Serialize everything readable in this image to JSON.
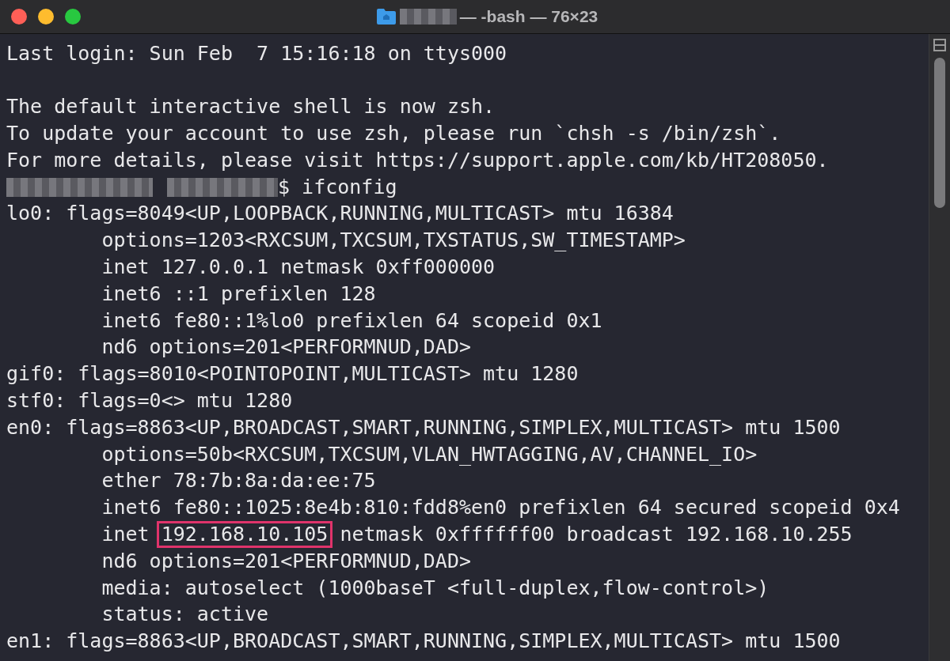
{
  "window": {
    "title": "— -bash — 76×23",
    "title_redacted": true
  },
  "terminal": {
    "lines": [
      {
        "kind": "output",
        "parts": [
          {
            "text": "Last login: Sun Feb  7 15:16:18 on ttys000",
            "highlighted": false
          }
        ]
      },
      {
        "kind": "blank"
      },
      {
        "kind": "output",
        "parts": [
          {
            "text": "The default interactive shell is now zsh.",
            "highlighted": false
          }
        ]
      },
      {
        "kind": "output",
        "parts": [
          {
            "text": "To update your account to use zsh, please run `chsh -s /bin/zsh`.",
            "highlighted": false
          }
        ]
      },
      {
        "kind": "output",
        "parts": [
          {
            "text": "For more details, please visit https://support.apple.com/kb/HT208050.",
            "highlighted": false
          }
        ]
      },
      {
        "kind": "prompt",
        "prompt_redacted": true,
        "parts": [
          {
            "text": "$ ifconfig",
            "highlighted": false
          }
        ]
      },
      {
        "kind": "output",
        "parts": [
          {
            "text": "lo0: flags=8049<UP,LOOPBACK,RUNNING,MULTICAST> mtu 16384",
            "highlighted": false
          }
        ]
      },
      {
        "kind": "output",
        "parts": [
          {
            "text": "        options=1203<RXCSUM,TXCSUM,TXSTATUS,SW_TIMESTAMP>",
            "highlighted": false
          }
        ]
      },
      {
        "kind": "output",
        "parts": [
          {
            "text": "        inet 127.0.0.1 netmask 0xff000000",
            "highlighted": false
          }
        ]
      },
      {
        "kind": "output",
        "parts": [
          {
            "text": "        inet6 ::1 prefixlen 128",
            "highlighted": false
          }
        ]
      },
      {
        "kind": "output",
        "parts": [
          {
            "text": "        inet6 fe80::1%lo0 prefixlen 64 scopeid 0x1",
            "highlighted": false
          }
        ]
      },
      {
        "kind": "output",
        "parts": [
          {
            "text": "        nd6 options=201<PERFORMNUD,DAD>",
            "highlighted": false
          }
        ]
      },
      {
        "kind": "output",
        "parts": [
          {
            "text": "gif0: flags=8010<POINTOPOINT,MULTICAST> mtu 1280",
            "highlighted": false
          }
        ]
      },
      {
        "kind": "output",
        "parts": [
          {
            "text": "stf0: flags=0<> mtu 1280",
            "highlighted": false
          }
        ]
      },
      {
        "kind": "output",
        "parts": [
          {
            "text": "en0: flags=8863<UP,BROADCAST,SMART,RUNNING,SIMPLEX,MULTICAST> mtu 1500",
            "highlighted": false
          }
        ]
      },
      {
        "kind": "output",
        "parts": [
          {
            "text": "        options=50b<RXCSUM,TXCSUM,VLAN_HWTAGGING,AV,CHANNEL_IO>",
            "highlighted": false
          }
        ]
      },
      {
        "kind": "output",
        "parts": [
          {
            "text": "        ether 78:7b:8a:da:ee:75",
            "highlighted": false
          }
        ]
      },
      {
        "kind": "output",
        "parts": [
          {
            "text": "        inet6 fe80::1025:8e4b:810:fdd8%en0 prefixlen 64 secured scopeid 0x4",
            "highlighted": false
          }
        ]
      },
      {
        "kind": "output",
        "parts": [
          {
            "text": "        inet ",
            "highlighted": false
          },
          {
            "text": "192.168.10.105",
            "highlighted": true
          },
          {
            "text": " netmask 0xffffff00 broadcast 192.168.10.255",
            "highlighted": false
          }
        ]
      },
      {
        "kind": "output",
        "parts": [
          {
            "text": "        nd6 options=201<PERFORMNUD,DAD>",
            "highlighted": false
          }
        ]
      },
      {
        "kind": "output",
        "parts": [
          {
            "text": "        media: autoselect (1000baseT <full-duplex,flow-control>)",
            "highlighted": false
          }
        ]
      },
      {
        "kind": "output",
        "parts": [
          {
            "text": "        status: active",
            "highlighted": false
          }
        ]
      },
      {
        "kind": "output",
        "parts": [
          {
            "text": "en1: flags=8863<UP,BROADCAST,SMART,RUNNING,SIMPLEX,MULTICAST> mtu 1500",
            "highlighted": false
          }
        ]
      }
    ]
  }
}
